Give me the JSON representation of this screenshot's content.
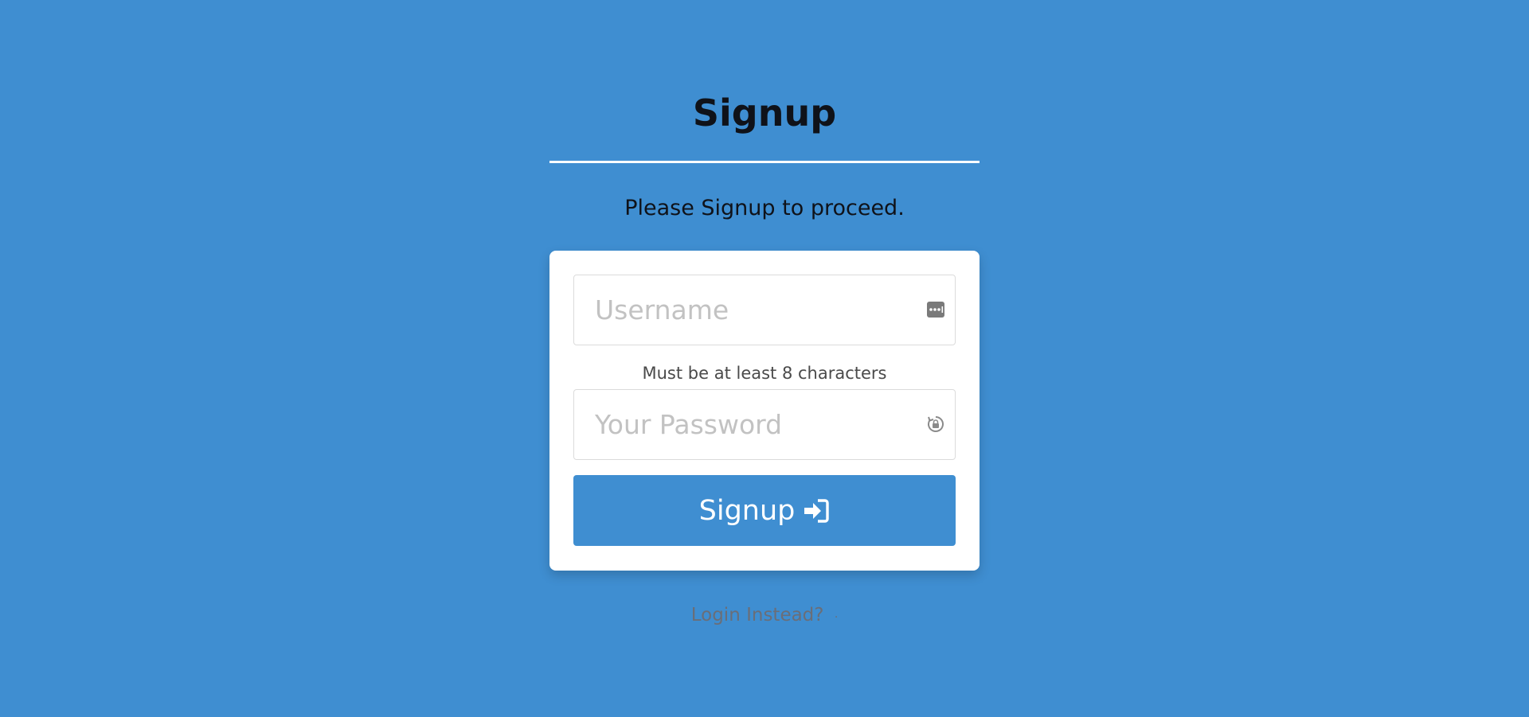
{
  "header": {
    "title": "Signup",
    "subtitle": "Please Signup to proceed."
  },
  "form": {
    "username": {
      "placeholder": "Username",
      "value": "",
      "icon": "password-manager-icon"
    },
    "hint": "Must be at least 8 characters",
    "password": {
      "placeholder": "Your Password",
      "value": "",
      "icon": "password-reveal-lock-icon"
    },
    "submit": {
      "label": "Signup",
      "icon": "sign-in-icon"
    }
  },
  "footer": {
    "login_label": "Login Instead?",
    "login_suffix": "·"
  },
  "colors": {
    "background": "#3f8ed1",
    "card": "#ffffff",
    "button": "#3f8ed1",
    "title_text": "#0f1219"
  }
}
